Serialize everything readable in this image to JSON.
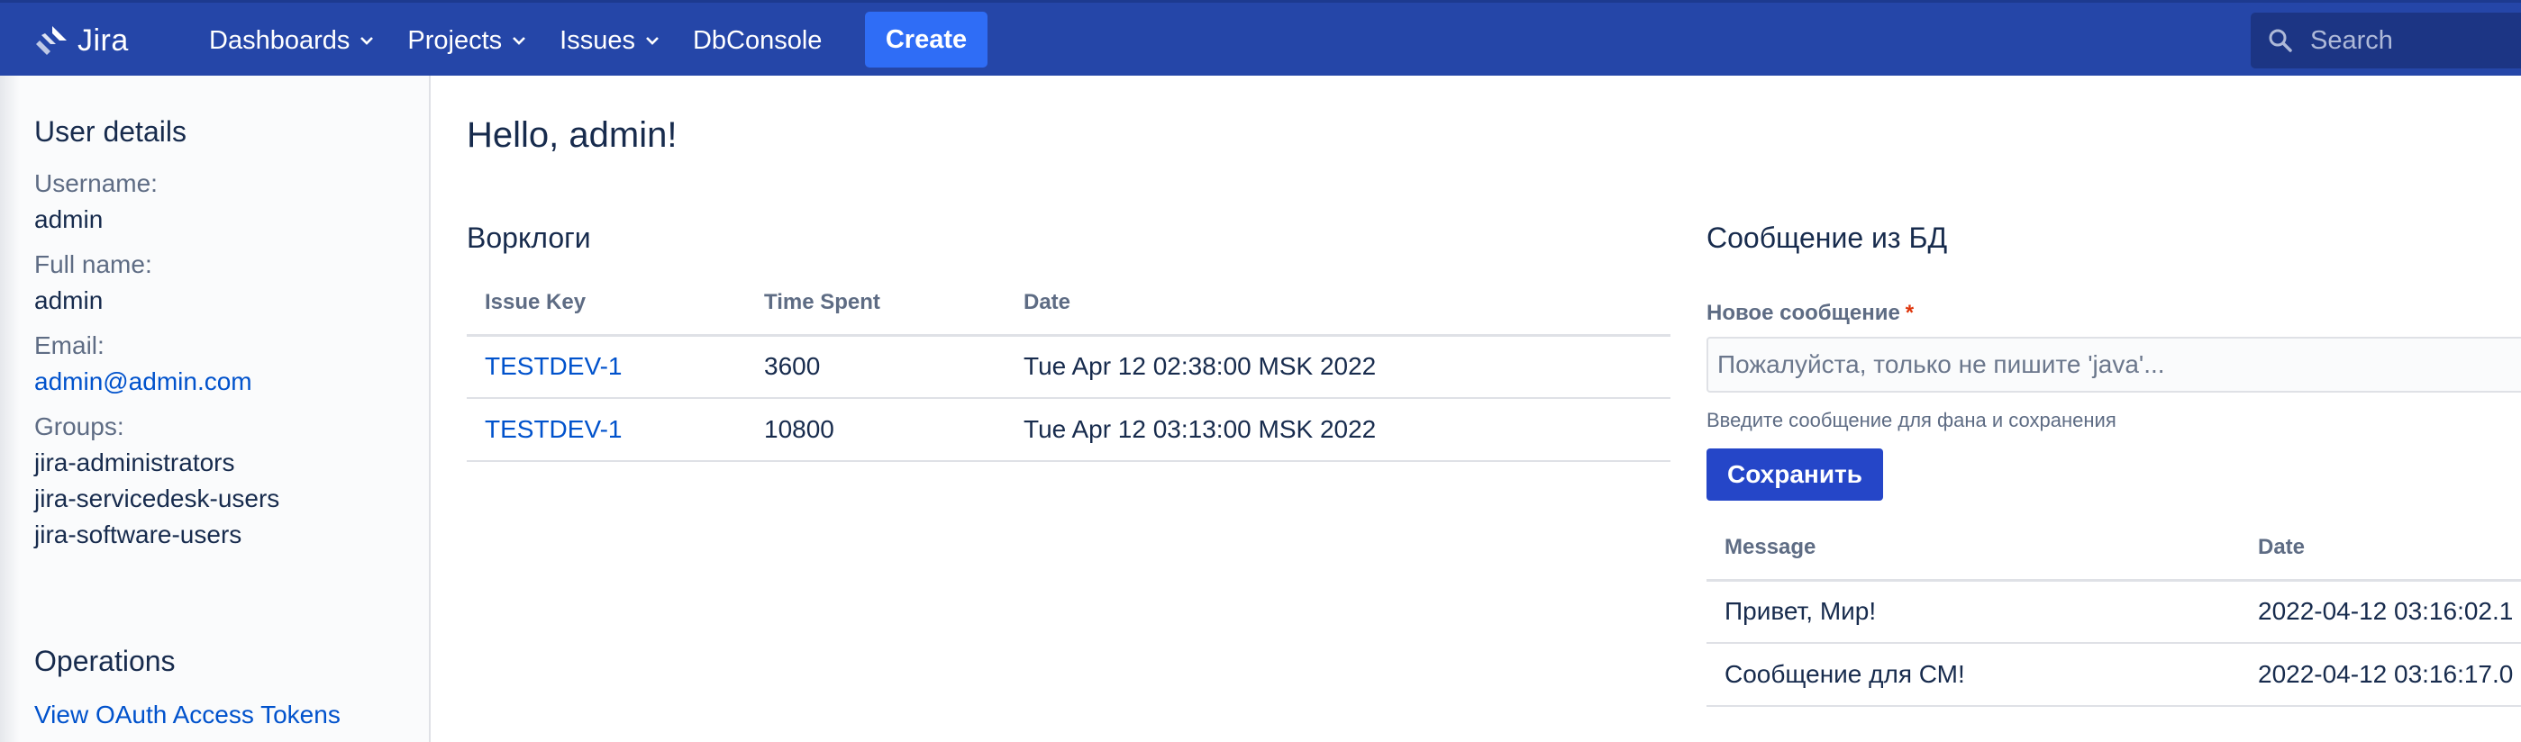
{
  "header": {
    "logo_text": "Jira",
    "nav": [
      {
        "label": "Dashboards",
        "dropdown": true
      },
      {
        "label": "Projects",
        "dropdown": true
      },
      {
        "label": "Issues",
        "dropdown": true
      },
      {
        "label": "DbConsole",
        "dropdown": false
      }
    ],
    "create_label": "Create",
    "search_placeholder": "Search"
  },
  "sidebar": {
    "user_details_title": "User details",
    "username_label": "Username:",
    "username": "admin",
    "fullname_label": "Full name:",
    "fullname": "admin",
    "email_label": "Email:",
    "email": "admin@admin.com",
    "groups_label": "Groups:",
    "groups": [
      "jira-administrators",
      "jira-servicedesk-users",
      "jira-software-users"
    ],
    "operations_title": "Operations",
    "operations_link": "View OAuth Access Tokens"
  },
  "main": {
    "greeting": "Hello, admin!",
    "worklogs": {
      "title": "Ворклоги",
      "columns": [
        "Issue Key",
        "Time Spent",
        "Date"
      ],
      "rows": [
        {
          "issue_key": "TESTDEV-1",
          "time_spent": "3600",
          "date": "Tue Apr 12 02:38:00 MSK 2022"
        },
        {
          "issue_key": "TESTDEV-1",
          "time_spent": "10800",
          "date": "Tue Apr 12 03:13:00 MSK 2022"
        }
      ]
    },
    "db_message": {
      "title": "Сообщение из БД",
      "field_label": "Новое сообщение",
      "required_mark": "*",
      "input_placeholder": "Пожалуйста, только не пишите 'java'...",
      "input_description": "Введите сообщение для фана и сохранения",
      "save_label": "Сохранить",
      "columns": [
        "Message",
        "Date"
      ],
      "rows": [
        {
          "message": "Привет, Мир!",
          "date": "2022-04-12 03:16:02.1"
        },
        {
          "message": "Сообщение для СМ!",
          "date": "2022-04-12 03:16:17.0"
        }
      ]
    }
  },
  "colors": {
    "header_bg": "#2546a8",
    "create_button": "#2f6df6",
    "link": "#0052cc",
    "primary_button": "#2546c8"
  }
}
